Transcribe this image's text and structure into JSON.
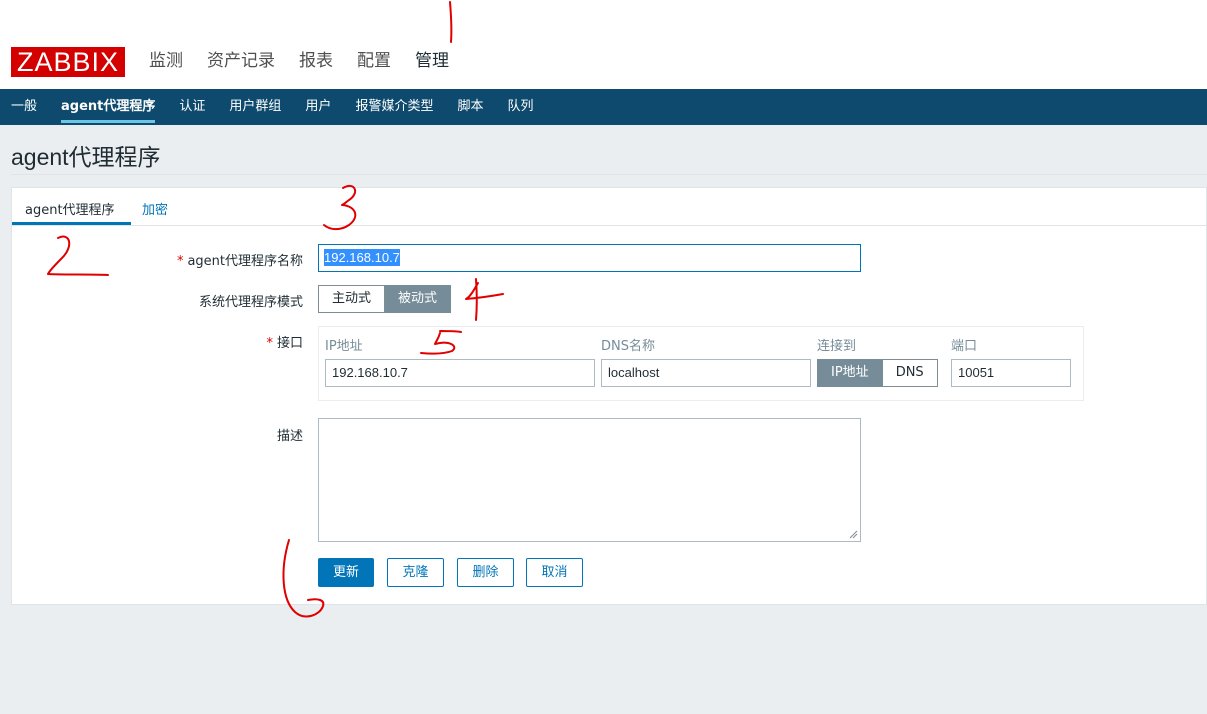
{
  "header": {
    "logo": "ZABBIX",
    "main_menu": [
      "监测",
      "资产记录",
      "报表",
      "配置",
      "管理"
    ],
    "active_menu": "管理"
  },
  "subnav": {
    "items": [
      "一般",
      "agent代理程序",
      "认证",
      "用户群组",
      "用户",
      "报警媒介类型",
      "脚本",
      "队列"
    ],
    "active": "agent代理程序"
  },
  "page": {
    "title": "agent代理程序"
  },
  "tabs": [
    "agent代理程序",
    "加密"
  ],
  "form": {
    "name_label": "agent代理程序名称",
    "name_value": "192.168.10.7",
    "mode_label": "系统代理程序模式",
    "mode_options": [
      "主动式",
      "被动式"
    ],
    "mode_selected": "被动式",
    "interface_label": "接口",
    "interface": {
      "headers": [
        "IP地址",
        "DNS名称",
        "连接到",
        "端口"
      ],
      "ip": "192.168.10.7",
      "dns": "localhost",
      "connect_options": [
        "IP地址",
        "DNS"
      ],
      "connect_selected": "IP地址",
      "port": "10051"
    },
    "description_label": "描述",
    "description_value": "",
    "required_marker": "*"
  },
  "buttons": {
    "update": "更新",
    "clone": "克隆",
    "delete": "删除",
    "cancel": "取消"
  },
  "annotations": [
    "1",
    "2",
    "3",
    "4",
    "5",
    "6"
  ],
  "colors": {
    "logo": "#d40000",
    "subnav": "#0e4a6d",
    "accent": "#0275b8",
    "annotation": "#e00000"
  }
}
